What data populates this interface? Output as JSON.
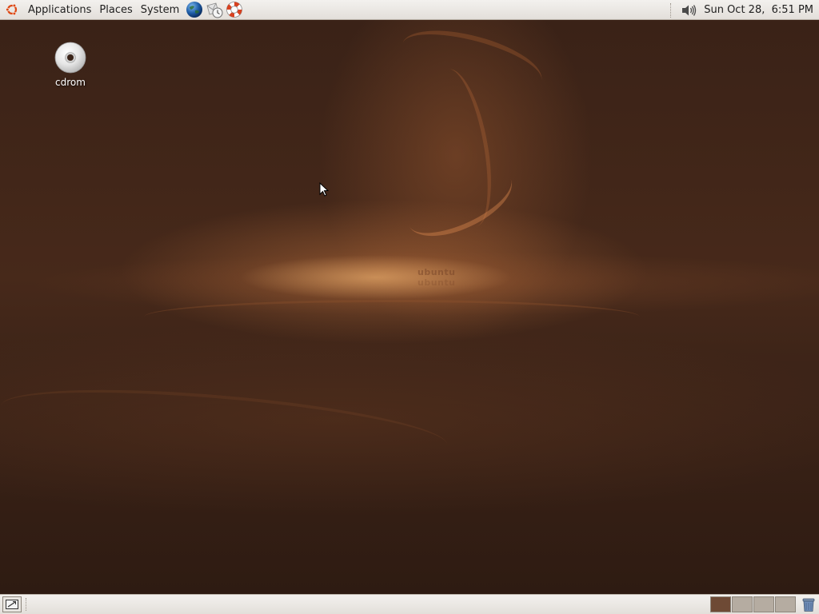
{
  "top_panel": {
    "menus": [
      "Applications",
      "Places",
      "System"
    ],
    "launchers": [
      "web-browser-globe-icon",
      "email-clock-icon",
      "help-lifebuoy-icon"
    ],
    "clock": "Sun Oct 28,  6:51 PM"
  },
  "desktop": {
    "icons": [
      {
        "label": "cdrom",
        "icon": "cdrom-icon"
      }
    ],
    "wallpaper_watermark": "ubuntu"
  },
  "bottom_panel": {
    "workspaces": 4,
    "active_workspace": 1
  },
  "colors": {
    "panel": "#e8e4df",
    "wallpaper": "#3d2418",
    "active_workspace": "#6e4a35",
    "ubuntu_orange": "#dd4814"
  }
}
